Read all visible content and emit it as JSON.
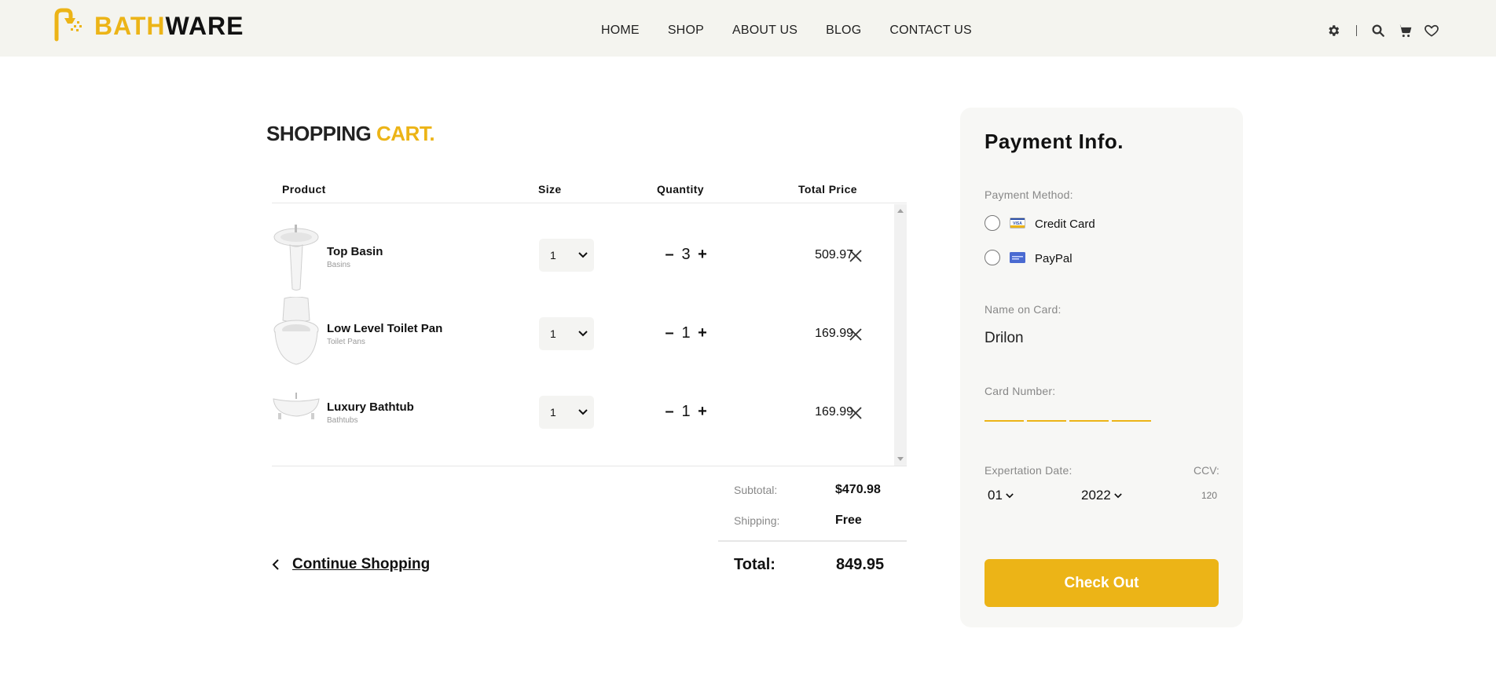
{
  "brand": {
    "part1": "BATH",
    "part2": "WARE",
    "accent": "#ecb417"
  },
  "nav": [
    "HOME",
    "SHOP",
    "ABOUT US",
    "BLOG",
    "CONTACT US"
  ],
  "header_icons": [
    "gear-icon",
    "search-icon",
    "cart-icon",
    "heart-icon"
  ],
  "cart": {
    "title_part1": "SHOPPING ",
    "title_part2": "CART.",
    "columns": [
      "Product",
      "Size",
      "Quantity",
      "Total Price"
    ],
    "items": [
      {
        "name": "Top Basin",
        "category": "Basins",
        "size": "1",
        "quantity": "3",
        "price": "509.97",
        "image": "basin-image"
      },
      {
        "name": "Low Level Toilet Pan",
        "category": "Toilet Pans",
        "size": "1",
        "quantity": "1",
        "price": "169.99",
        "image": "toilet-image"
      },
      {
        "name": "Luxury Bathtub",
        "category": "Bathtubs",
        "size": "1",
        "quantity": "1",
        "price": "169.99",
        "image": "bathtub-image"
      }
    ],
    "qty_minus": "–",
    "qty_plus": "+",
    "subtotal_label": "Subtotal:",
    "subtotal_value": "$470.98",
    "shipping_label": "Shipping:",
    "shipping_value": "Free",
    "total_label": "Total:",
    "total_value": "849.95",
    "continue_label": "Continue Shopping"
  },
  "payment": {
    "title": "Payment Info.",
    "method_label": "Payment Method:",
    "methods": [
      "Credit Card",
      "PayPal"
    ],
    "name_label": "Name on Card:",
    "name_value": "Drilon",
    "card_number_label": "Card Number:",
    "exp_label": "Expertation Date:",
    "exp_month": "01",
    "exp_year": "2022",
    "ccv_label": "CCV:",
    "ccv_value": "120",
    "checkout_label": "Check Out"
  }
}
